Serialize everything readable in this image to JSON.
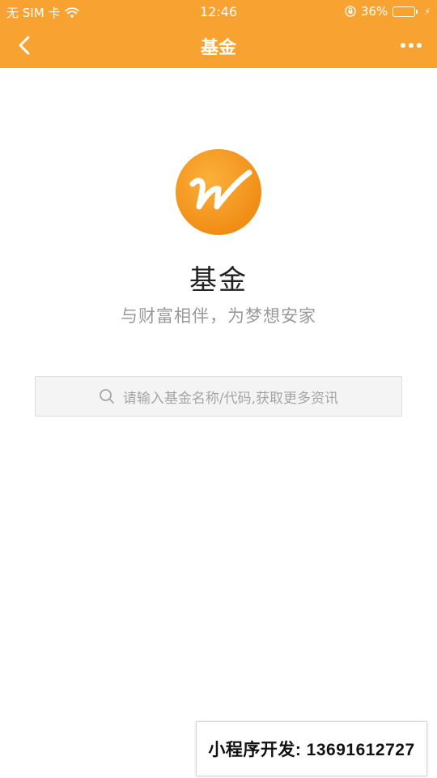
{
  "status_bar": {
    "carrier": "无 SIM 卡",
    "time": "12:46",
    "battery_percent": "36%",
    "battery_level": 0.36,
    "icons": [
      "wifi-icon",
      "orientation-lock-icon",
      "battery-icon",
      "charging-bolt-icon"
    ]
  },
  "nav": {
    "title": "基金",
    "back_icon": "chevron-left-icon",
    "more_icon": "more-dots-icon"
  },
  "main": {
    "logo_icon": "wind-w-logo",
    "app_name": "基金",
    "tagline": "与财富相伴，为梦想安家"
  },
  "search": {
    "placeholder": "请输入基金名称/代码,获取更多资讯",
    "icon": "search-icon"
  },
  "banner": {
    "text": "小程序开发: 13691612727"
  },
  "colors": {
    "header_bg": "#f8a231",
    "logo_orange": "#f59a1c",
    "search_bg": "#f4f4f4",
    "text_primary": "#222222",
    "text_secondary": "#999999"
  }
}
